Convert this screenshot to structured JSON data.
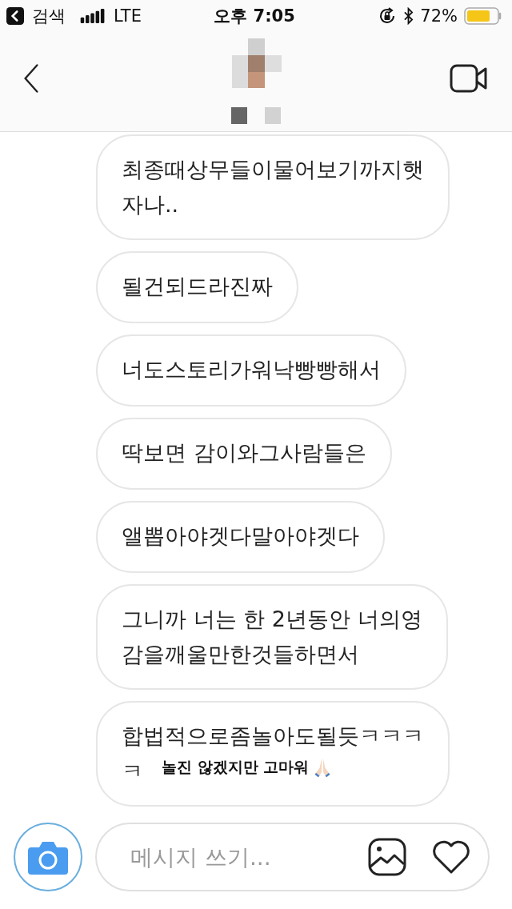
{
  "status_bar": {
    "back_app": "검색",
    "network": "LTE",
    "time": "오후 7:05",
    "battery": "72%"
  },
  "messages": [
    {
      "lines": [
        "최종때상무들이물어보기까지햇",
        "자나.."
      ]
    },
    {
      "lines": [
        "될건되드라진짜"
      ]
    },
    {
      "lines": [
        "너도스토리가워낙빵빵해서"
      ]
    },
    {
      "lines": [
        "딱보면 감이와그사람들은"
      ]
    },
    {
      "lines": [
        "앨뽑아야겟다말아야겟다"
      ]
    },
    {
      "lines": [
        "그니까 너는 한 2년동안 너의영",
        "감을깨울만한것들하면서"
      ]
    },
    {
      "lines": [
        "합법적으로좀놀아도될듯ㅋㅋㅋ",
        "ㅋ"
      ],
      "caption": "놀진 않겠지만 고마워"
    }
  ],
  "composer": {
    "placeholder": "메시지 쓰기..."
  }
}
